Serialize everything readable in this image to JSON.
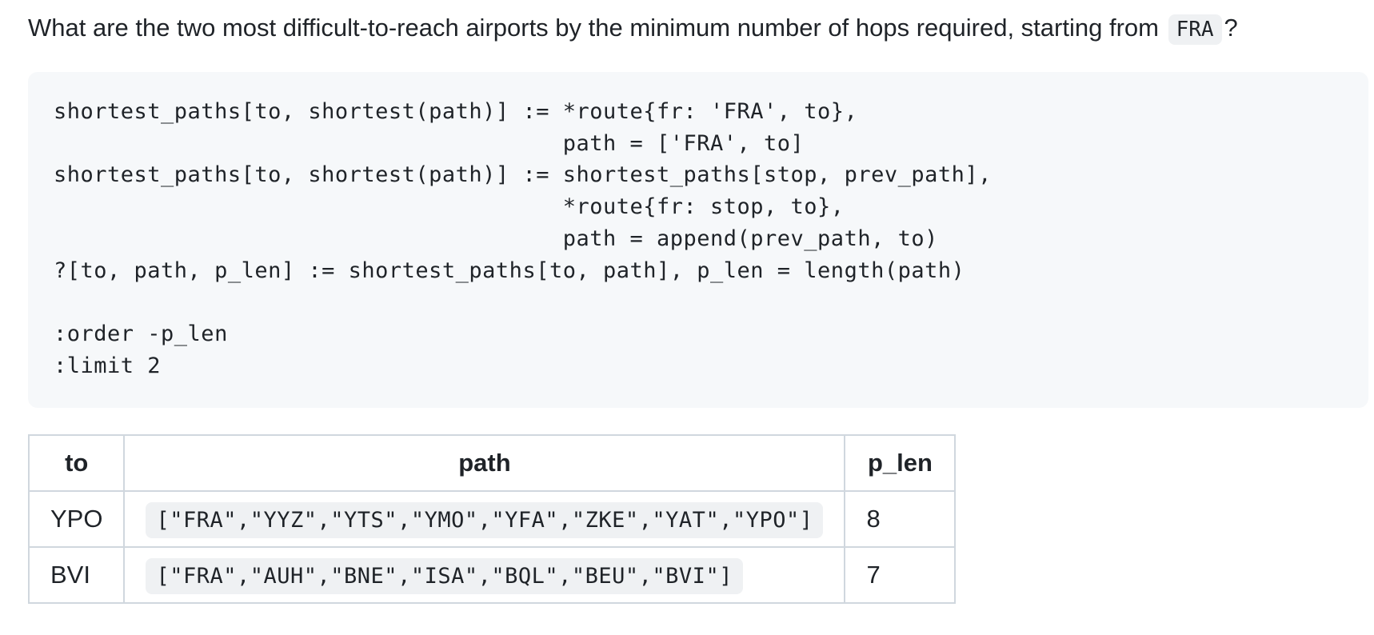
{
  "question": {
    "text_before": "What are the two most difficult-to-reach airports by the minimum number of hops required, starting from",
    "code": "FRA",
    "text_after": "?"
  },
  "code_block": {
    "code": "shortest_paths[to, shortest(path)] := *route{fr: 'FRA', to},\n                                      path = ['FRA', to]\nshortest_paths[to, shortest(path)] := shortest_paths[stop, prev_path],\n                                      *route{fr: stop, to},\n                                      path = append(prev_path, to)\n?[to, path, p_len] := shortest_paths[to, path], p_len = length(path)\n\n:order -p_len\n:limit 2"
  },
  "result_table": {
    "headers": [
      "to",
      "path",
      "p_len"
    ],
    "rows": [
      {
        "to": "YPO",
        "path": "[\"FRA\",\"YYZ\",\"YTS\",\"YMO\",\"YFA\",\"ZKE\",\"YAT\",\"YPO\"]",
        "p_len": "8"
      },
      {
        "to": "BVI",
        "path": "[\"FRA\",\"AUH\",\"BNE\",\"ISA\",\"BQL\",\"BEU\",\"BVI\"]",
        "p_len": "7"
      }
    ]
  }
}
